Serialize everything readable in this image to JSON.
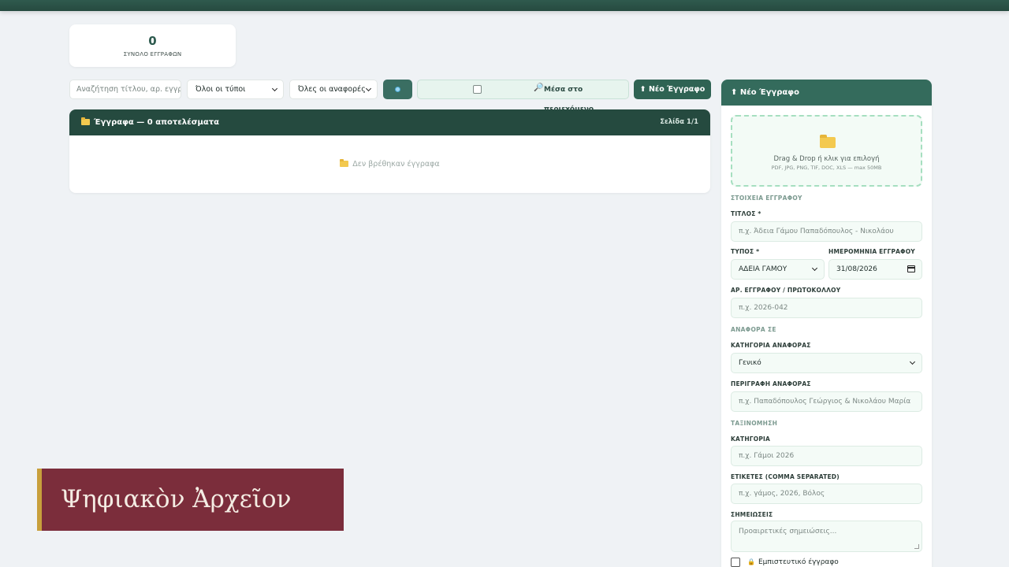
{
  "stats": {
    "total_count": "0",
    "total_label": "ΣΥΝΟΛΟ ΕΓΓΡΑΦΩΝ"
  },
  "toolbar": {
    "search_placeholder": "Αναζήτηση τίτλου, αρ. εγγρ.",
    "type_filter": "Όλοι οι τύποι",
    "reference_filter": "Όλες οι αναφορές",
    "content_search_label": "Μέσα στο περιεχόμενο",
    "content_search_icon": "🔎",
    "new_doc_label": "⬆ Νέο Έγγραφο"
  },
  "list": {
    "title": "Έγγραφα — 0 αποτελέσματα",
    "page": "Σελίδα 1/1",
    "empty_text": "Δεν βρέθηκαν έγγραφα"
  },
  "form": {
    "title": "⬆ Νέο Έγγραφο",
    "dropzone": {
      "text": "Drag & Drop ή κλικ για επιλογή",
      "formats": "PDF, JPG, PNG, TIF, DOC, XLS — max 50MB"
    },
    "section_details": "ΣΤΟΙΧΕΙΑ ΕΓΓΡΑΦΟΥ",
    "title_label": "ΤΙΤΛΟΣ *",
    "title_placeholder": "π.χ. Άδεια Γάμου Παπαδόπουλος - Νικολάου",
    "type_label": "ΤΥΠΟΣ *",
    "type_value": "ΑΔΕΙΑ ΓΑΜΟΥ",
    "date_label": "ΗΜΕΡΟΜΗΝΙΑ ΕΓΓΡΑΦΟΥ",
    "date_value": "31/08/2026",
    "number_label": "ΑΡ. ΕΓΓΡΑΦΟΥ / ΠΡΩΤΟΚΟΛΛΟΥ",
    "number_placeholder": "π.χ. 2026-042",
    "section_reference": "ΑΝΑΦΟΡΑ ΣΕ",
    "ref_category_label": "ΚΑΤΗΓΟΡΙΑ ΑΝΑΦΟΡΑΣ",
    "ref_category_value": "Γενικό",
    "ref_desc_label": "ΠΕΡΙΓΡΑΦΗ ΑΝΑΦΟΡΑΣ",
    "ref_desc_placeholder": "π.χ. Παπαδόπουλος Γεώργιος & Νικολάου Μαρία",
    "section_classification": "ΤΑΞΙΝΟΜΗΣΗ",
    "category_label": "ΚΑΤΗΓΟΡΙΑ",
    "category_placeholder": "π.χ. Γάμοι 2026",
    "tags_label": "ΕΤΙΚΕΤΕΣ (COMMA SEPARATED)",
    "tags_placeholder": "π.χ. γάμος, 2026, Βόλος",
    "notes_label": "ΣΗΜΕΙΩΣΕΙΣ",
    "notes_placeholder": "Προαιρετικές σημειώσεις...",
    "confidential_label": "Εμπιστευτικό έγγραφο",
    "confidential_icon": "🔒"
  },
  "brand": {
    "name": "Ψηφιακὸν Ἀρχεῖον"
  },
  "colors": {
    "primary": "#2f6353",
    "header_dark": "#254a3f",
    "brand_bg": "#7b2d3b",
    "brand_accent": "#c8a03c"
  }
}
